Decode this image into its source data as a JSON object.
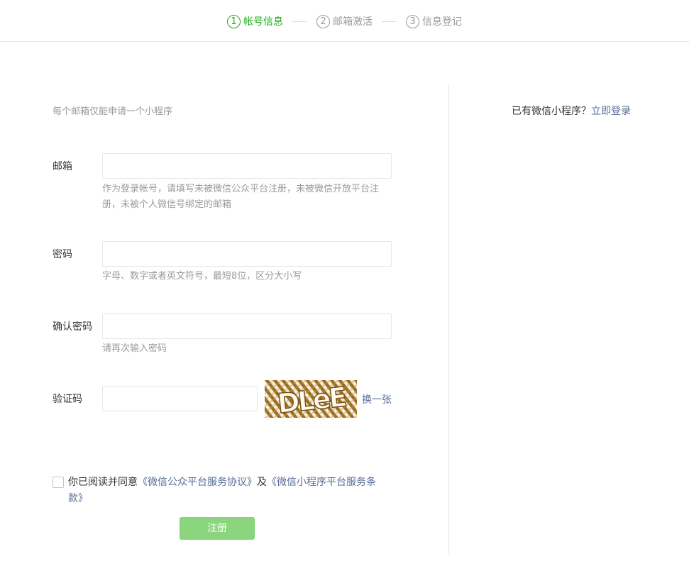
{
  "steps": [
    {
      "num": "1",
      "label": "帐号信息"
    },
    {
      "num": "2",
      "label": "邮箱激活"
    },
    {
      "num": "3",
      "label": "信息登记"
    }
  ],
  "colors": {
    "active": "#1aad19",
    "link": "#576b95",
    "muted": "#9a9a9a",
    "submit_disabled": "#8bd57e"
  },
  "form": {
    "tip": "每个邮箱仅能申请一个小程序",
    "email": {
      "label": "邮箱",
      "value": "",
      "hint": "作为登录帐号，请填写未被微信公众平台注册，未被微信开放平台注册，未被个人微信号绑定的邮箱"
    },
    "password": {
      "label": "密码",
      "value": "",
      "hint": "字母、数字或者英文符号，最短8位，区分大小写"
    },
    "confirm": {
      "label": "确认密码",
      "value": "",
      "hint": "请再次输入密码"
    },
    "captcha": {
      "label": "验证码",
      "value": "",
      "image_text": "DLeE",
      "refresh": "换一张"
    },
    "agreement": {
      "prefix": "你已阅读并同意",
      "link1": "《微信公众平台服务协议》",
      "middle": "及",
      "link2": "《微信小程序平台服务条款》",
      "checked": false
    },
    "submit": "注册"
  },
  "side": {
    "question": "已有微信小程序？",
    "login_link": "立即登录"
  }
}
